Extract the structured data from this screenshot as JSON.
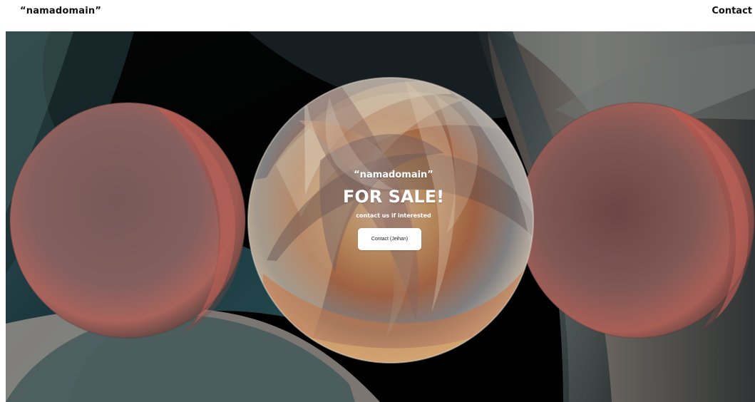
{
  "header": {
    "brand_text": "“namadomain”",
    "nav_contact_label": "Contact"
  },
  "hero": {
    "kicker": "“namadomain”",
    "title": "FOR SALE!",
    "subtitle": "contact us if interested",
    "button_label": "Contact (Jeihan)"
  },
  "colors": {
    "background": "#ffffff",
    "hero_dark": "#000000",
    "text_dark": "#111111",
    "text_light": "#ffffff",
    "sphere_left": "#9a6b67",
    "sphere_center": "#c9a36e",
    "sphere_right": "#8c625f",
    "teal_shape": "#223b43",
    "grey_shape": "#7a756f"
  }
}
